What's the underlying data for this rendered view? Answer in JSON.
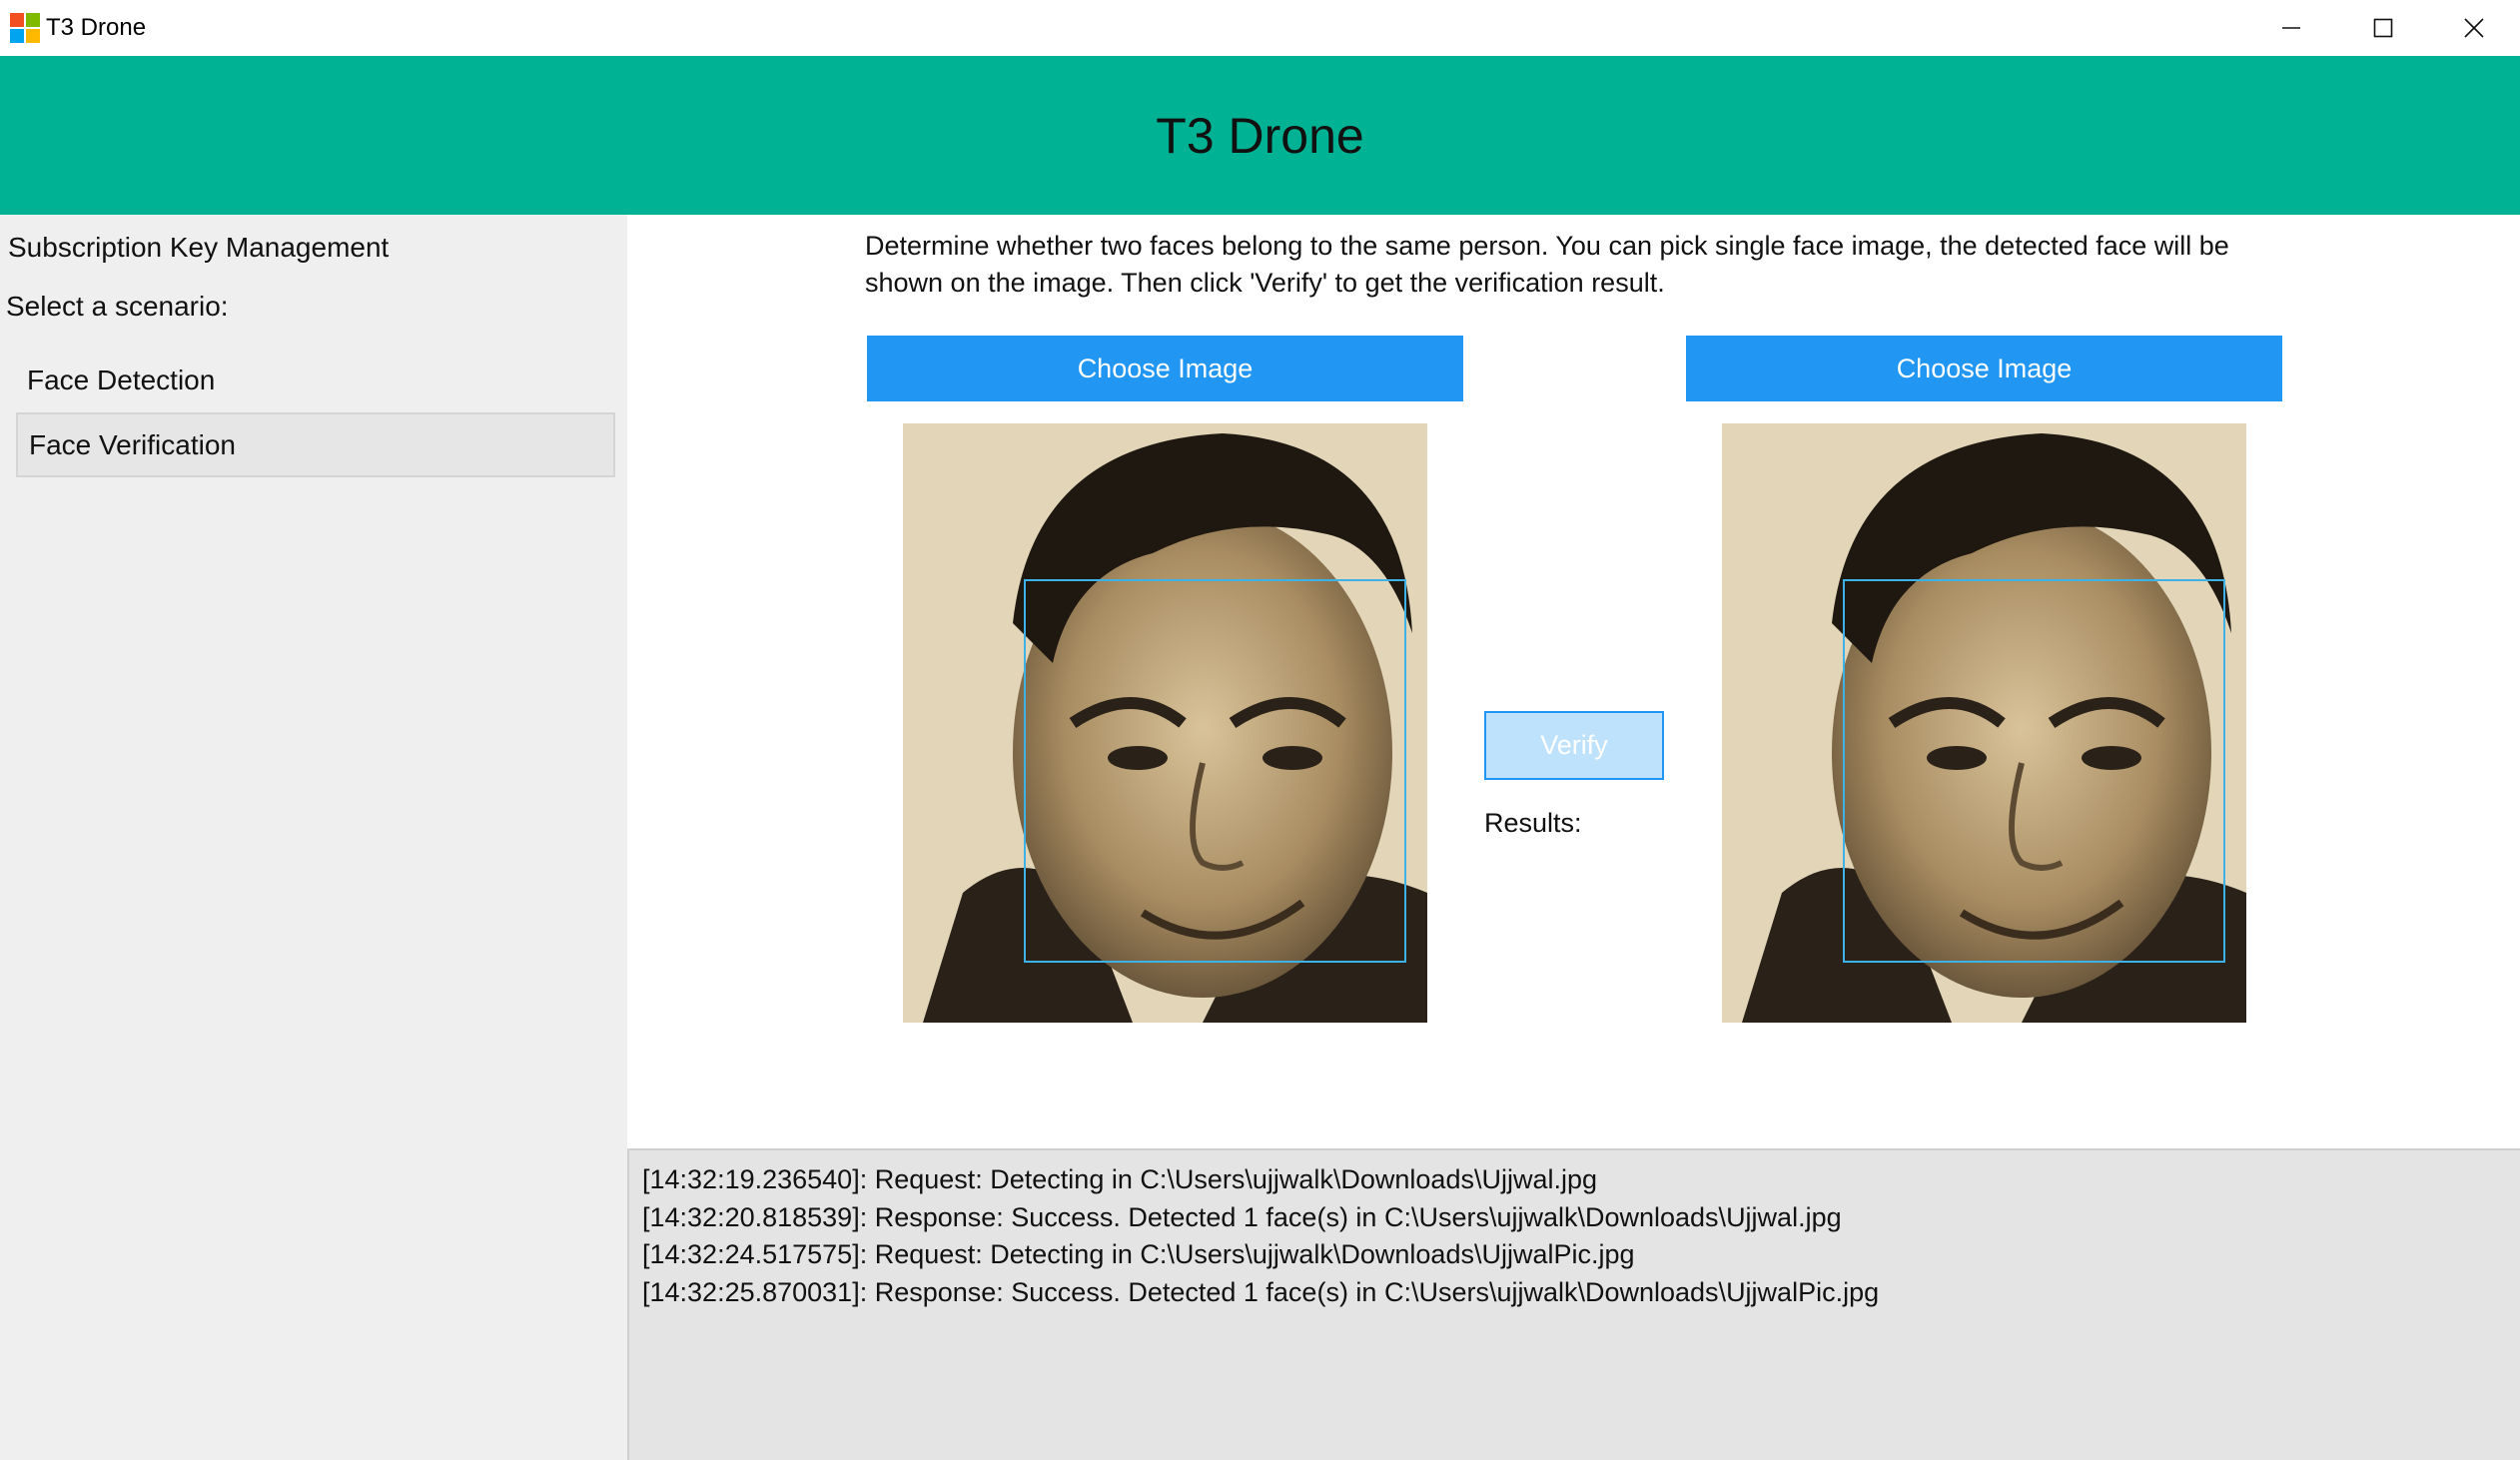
{
  "window": {
    "title": "T3 Drone",
    "logo_colors": [
      "#f25022",
      "#7fba00",
      "#00a4ef",
      "#ffb900"
    ],
    "controls": [
      "minimize-icon",
      "maximize-icon",
      "close-icon"
    ]
  },
  "header": {
    "title": "T3 Drone",
    "background": "#00b294"
  },
  "sidebar": {
    "subscription_link": "Subscription Key Management",
    "select_label": "Select a scenario:",
    "items": [
      {
        "label": "Face Detection",
        "selected": false
      },
      {
        "label": "Face Verification",
        "selected": true
      }
    ]
  },
  "main": {
    "description": "Determine whether two faces belong to the same person. You can pick single face image, the detected face will be shown on the image. Then click 'Verify' to get the verification result.",
    "choose_left_label": "Choose Image",
    "choose_right_label": "Choose Image",
    "verify_label": "Verify",
    "results_label": "Results:",
    "accent": "#2196f3"
  },
  "log": [
    "[14:32:19.236540]: Request: Detecting in C:\\Users\\ujjwalk\\Downloads\\Ujjwal.jpg",
    "[14:32:20.818539]: Response: Success. Detected 1 face(s) in C:\\Users\\ujjwalk\\Downloads\\Ujjwal.jpg",
    "[14:32:24.517575]: Request: Detecting in C:\\Users\\ujjwalk\\Downloads\\UjjwalPic.jpg",
    "[14:32:25.870031]: Response: Success. Detected 1 face(s) in C:\\Users\\ujjwalk\\Downloads\\UjjwalPic.jpg"
  ]
}
